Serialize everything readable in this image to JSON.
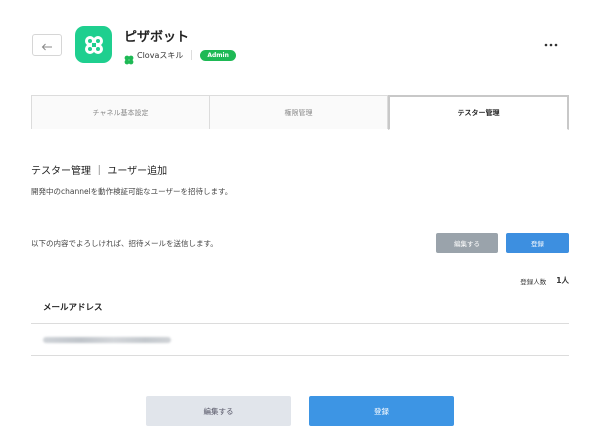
{
  "header": {
    "back_icon": "arrow-left-icon",
    "app_title": "ピザボット",
    "platform_label": "Clovaスキル",
    "role_badge": "Admin",
    "more_icon": "more-horizontal-icon"
  },
  "tabs": [
    {
      "label": "チャネル基本設定",
      "active": false
    },
    {
      "label": "権限管理",
      "active": false
    },
    {
      "label": "テスター管理",
      "active": true
    }
  ],
  "main": {
    "section_title": "テスター管理 ｜ ユーザー追加",
    "section_description": "開発中のchannelを動作検証可能なユーザーを招待します。",
    "confirm_text": "以下の内容でよろしければ、招待メールを送信します。",
    "edit_label": "編集する",
    "register_label": "登録",
    "count_label": "登録人数",
    "count_value": "1人",
    "email_column_header": "メールアドレス"
  },
  "footer": {
    "edit_label": "編集する",
    "register_label": "登録"
  },
  "colors": {
    "app_icon": "#1fcf8f",
    "admin_badge": "#1eb955",
    "primary_button": "#3d8fe0",
    "secondary_button": "#9aa3ab"
  }
}
